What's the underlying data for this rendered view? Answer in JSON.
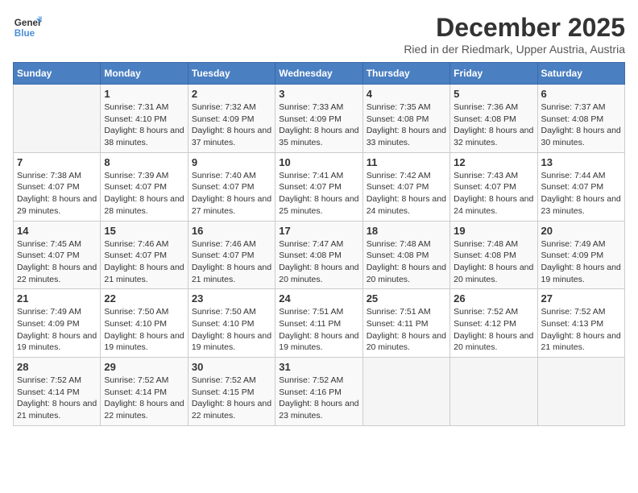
{
  "header": {
    "logo": {
      "general": "General",
      "blue": "Blue"
    },
    "title": "December 2025",
    "subtitle": "Ried in der Riedmark, Upper Austria, Austria"
  },
  "calendar": {
    "days_of_week": [
      "Sunday",
      "Monday",
      "Tuesday",
      "Wednesday",
      "Thursday",
      "Friday",
      "Saturday"
    ],
    "weeks": [
      [
        {
          "day": "",
          "sunrise": "",
          "sunset": "",
          "daylight": ""
        },
        {
          "day": "1",
          "sunrise": "Sunrise: 7:31 AM",
          "sunset": "Sunset: 4:10 PM",
          "daylight": "Daylight: 8 hours and 38 minutes."
        },
        {
          "day": "2",
          "sunrise": "Sunrise: 7:32 AM",
          "sunset": "Sunset: 4:09 PM",
          "daylight": "Daylight: 8 hours and 37 minutes."
        },
        {
          "day": "3",
          "sunrise": "Sunrise: 7:33 AM",
          "sunset": "Sunset: 4:09 PM",
          "daylight": "Daylight: 8 hours and 35 minutes."
        },
        {
          "day": "4",
          "sunrise": "Sunrise: 7:35 AM",
          "sunset": "Sunset: 4:08 PM",
          "daylight": "Daylight: 8 hours and 33 minutes."
        },
        {
          "day": "5",
          "sunrise": "Sunrise: 7:36 AM",
          "sunset": "Sunset: 4:08 PM",
          "daylight": "Daylight: 8 hours and 32 minutes."
        },
        {
          "day": "6",
          "sunrise": "Sunrise: 7:37 AM",
          "sunset": "Sunset: 4:08 PM",
          "daylight": "Daylight: 8 hours and 30 minutes."
        }
      ],
      [
        {
          "day": "7",
          "sunrise": "Sunrise: 7:38 AM",
          "sunset": "Sunset: 4:07 PM",
          "daylight": "Daylight: 8 hours and 29 minutes."
        },
        {
          "day": "8",
          "sunrise": "Sunrise: 7:39 AM",
          "sunset": "Sunset: 4:07 PM",
          "daylight": "Daylight: 8 hours and 28 minutes."
        },
        {
          "day": "9",
          "sunrise": "Sunrise: 7:40 AM",
          "sunset": "Sunset: 4:07 PM",
          "daylight": "Daylight: 8 hours and 27 minutes."
        },
        {
          "day": "10",
          "sunrise": "Sunrise: 7:41 AM",
          "sunset": "Sunset: 4:07 PM",
          "daylight": "Daylight: 8 hours and 25 minutes."
        },
        {
          "day": "11",
          "sunrise": "Sunrise: 7:42 AM",
          "sunset": "Sunset: 4:07 PM",
          "daylight": "Daylight: 8 hours and 24 minutes."
        },
        {
          "day": "12",
          "sunrise": "Sunrise: 7:43 AM",
          "sunset": "Sunset: 4:07 PM",
          "daylight": "Daylight: 8 hours and 24 minutes."
        },
        {
          "day": "13",
          "sunrise": "Sunrise: 7:44 AM",
          "sunset": "Sunset: 4:07 PM",
          "daylight": "Daylight: 8 hours and 23 minutes."
        }
      ],
      [
        {
          "day": "14",
          "sunrise": "Sunrise: 7:45 AM",
          "sunset": "Sunset: 4:07 PM",
          "daylight": "Daylight: 8 hours and 22 minutes."
        },
        {
          "day": "15",
          "sunrise": "Sunrise: 7:46 AM",
          "sunset": "Sunset: 4:07 PM",
          "daylight": "Daylight: 8 hours and 21 minutes."
        },
        {
          "day": "16",
          "sunrise": "Sunrise: 7:46 AM",
          "sunset": "Sunset: 4:07 PM",
          "daylight": "Daylight: 8 hours and 21 minutes."
        },
        {
          "day": "17",
          "sunrise": "Sunrise: 7:47 AM",
          "sunset": "Sunset: 4:08 PM",
          "daylight": "Daylight: 8 hours and 20 minutes."
        },
        {
          "day": "18",
          "sunrise": "Sunrise: 7:48 AM",
          "sunset": "Sunset: 4:08 PM",
          "daylight": "Daylight: 8 hours and 20 minutes."
        },
        {
          "day": "19",
          "sunrise": "Sunrise: 7:48 AM",
          "sunset": "Sunset: 4:08 PM",
          "daylight": "Daylight: 8 hours and 20 minutes."
        },
        {
          "day": "20",
          "sunrise": "Sunrise: 7:49 AM",
          "sunset": "Sunset: 4:09 PM",
          "daylight": "Daylight: 8 hours and 19 minutes."
        }
      ],
      [
        {
          "day": "21",
          "sunrise": "Sunrise: 7:49 AM",
          "sunset": "Sunset: 4:09 PM",
          "daylight": "Daylight: 8 hours and 19 minutes."
        },
        {
          "day": "22",
          "sunrise": "Sunrise: 7:50 AM",
          "sunset": "Sunset: 4:10 PM",
          "daylight": "Daylight: 8 hours and 19 minutes."
        },
        {
          "day": "23",
          "sunrise": "Sunrise: 7:50 AM",
          "sunset": "Sunset: 4:10 PM",
          "daylight": "Daylight: 8 hours and 19 minutes."
        },
        {
          "day": "24",
          "sunrise": "Sunrise: 7:51 AM",
          "sunset": "Sunset: 4:11 PM",
          "daylight": "Daylight: 8 hours and 19 minutes."
        },
        {
          "day": "25",
          "sunrise": "Sunrise: 7:51 AM",
          "sunset": "Sunset: 4:11 PM",
          "daylight": "Daylight: 8 hours and 20 minutes."
        },
        {
          "day": "26",
          "sunrise": "Sunrise: 7:52 AM",
          "sunset": "Sunset: 4:12 PM",
          "daylight": "Daylight: 8 hours and 20 minutes."
        },
        {
          "day": "27",
          "sunrise": "Sunrise: 7:52 AM",
          "sunset": "Sunset: 4:13 PM",
          "daylight": "Daylight: 8 hours and 21 minutes."
        }
      ],
      [
        {
          "day": "28",
          "sunrise": "Sunrise: 7:52 AM",
          "sunset": "Sunset: 4:14 PM",
          "daylight": "Daylight: 8 hours and 21 minutes."
        },
        {
          "day": "29",
          "sunrise": "Sunrise: 7:52 AM",
          "sunset": "Sunset: 4:14 PM",
          "daylight": "Daylight: 8 hours and 22 minutes."
        },
        {
          "day": "30",
          "sunrise": "Sunrise: 7:52 AM",
          "sunset": "Sunset: 4:15 PM",
          "daylight": "Daylight: 8 hours and 22 minutes."
        },
        {
          "day": "31",
          "sunrise": "Sunrise: 7:52 AM",
          "sunset": "Sunset: 4:16 PM",
          "daylight": "Daylight: 8 hours and 23 minutes."
        },
        {
          "day": "",
          "sunrise": "",
          "sunset": "",
          "daylight": ""
        },
        {
          "day": "",
          "sunrise": "",
          "sunset": "",
          "daylight": ""
        },
        {
          "day": "",
          "sunrise": "",
          "sunset": "",
          "daylight": ""
        }
      ]
    ]
  }
}
